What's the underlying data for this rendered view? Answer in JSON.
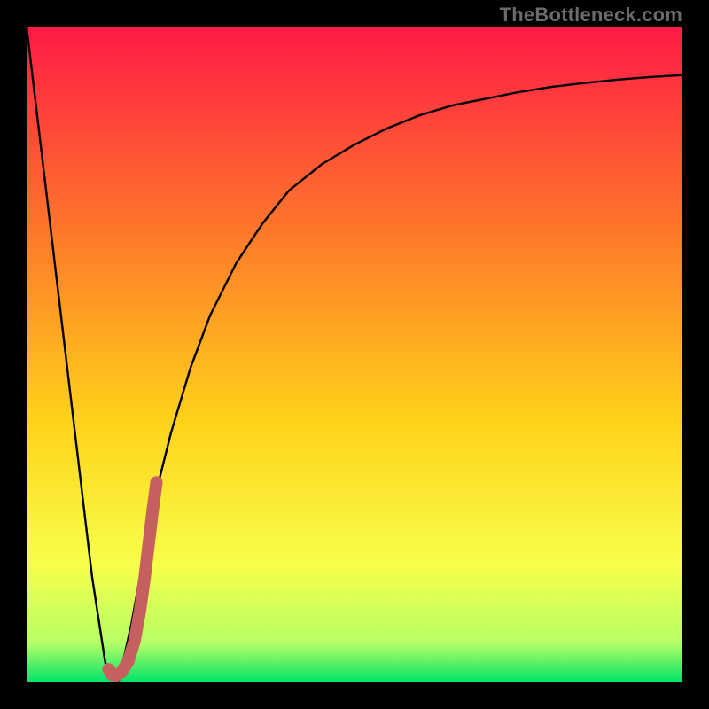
{
  "watermark_text": "TheBottleneck.com",
  "colors": {
    "frame": "#000000",
    "gradient_top": "#ff1a46",
    "gradient_mid1": "#ff7a2a",
    "gradient_mid2": "#ffd21a",
    "gradient_low1": "#f8ff4a",
    "gradient_low2": "#b6ff66",
    "gradient_bottom": "#00e26a",
    "curve": "#000000",
    "highlight": "#c6605e"
  },
  "chart_data": {
    "type": "line",
    "title": "",
    "xlabel": "",
    "ylabel": "",
    "xlim": [
      0,
      100
    ],
    "ylim": [
      0,
      100
    ],
    "grid": false,
    "legend": false,
    "series": [
      {
        "name": "bottleneck_curve",
        "x": [
          0,
          5,
          10,
          12,
          14,
          16,
          18,
          20,
          22,
          25,
          28,
          32,
          36,
          40,
          45,
          50,
          55,
          60,
          65,
          70,
          75,
          80,
          85,
          90,
          95,
          100
        ],
        "values": [
          100,
          58,
          16,
          3,
          0,
          9,
          20,
          30,
          38,
          48,
          56,
          64,
          70,
          75,
          79,
          82,
          84.5,
          86.5,
          88,
          89,
          90,
          90.8,
          91.4,
          91.9,
          92.3,
          92.6
        ]
      },
      {
        "name": "highlight_segment",
        "x": [
          12.5,
          13,
          13.6,
          14.5,
          15.5,
          16.5,
          17.3,
          18,
          18.6,
          19.2,
          19.8
        ],
        "values": [
          2,
          1.2,
          1,
          1.6,
          3.2,
          6.5,
          11,
          16,
          21,
          26,
          30.5
        ]
      }
    ]
  }
}
